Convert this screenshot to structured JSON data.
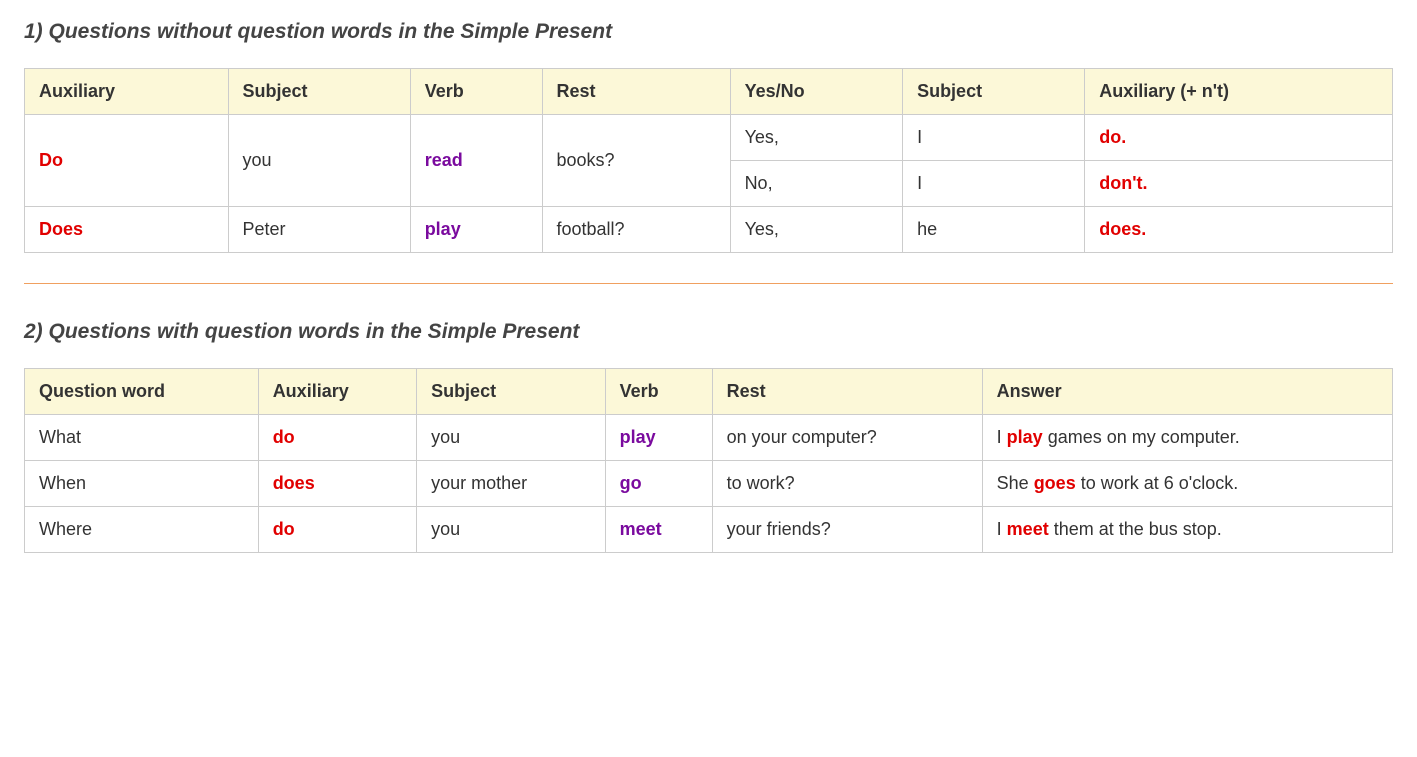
{
  "section1": {
    "heading": "1) Questions without question words in the Simple Present",
    "headers": {
      "aux": "Auxiliary",
      "subject": "Subject",
      "verb": "Verb",
      "rest": "Rest",
      "yesno": "Yes/No",
      "subject2": "Subject",
      "aux2": "Auxiliary (+ n't)"
    },
    "rows": {
      "r1": {
        "aux": "Do",
        "subject": "you",
        "verb": "read",
        "rest": "books?",
        "yesno": "Yes,",
        "subject2": "I",
        "aux2": "do."
      },
      "r2": {
        "yesno": "No,",
        "subject2": "I",
        "aux2": "don't."
      },
      "r3": {
        "aux": "Does",
        "subject": "Peter",
        "verb": "play",
        "rest": "football?",
        "yesno": "Yes,",
        "subject2": "he",
        "aux2": "does."
      }
    }
  },
  "section2": {
    "heading": "2) Questions with question words in the Simple Present",
    "headers": {
      "qword": "Question word",
      "aux": "Auxiliary",
      "subject": "Subject",
      "verb": "Verb",
      "rest": "Rest",
      "answer": "Answer"
    },
    "rows": {
      "r1": {
        "qword": "What",
        "aux": "do",
        "subject": "you",
        "verb": "play",
        "rest": "on your computer?",
        "ans_pre": "I ",
        "ans_hl": "play",
        "ans_post": " games on my computer."
      },
      "r2": {
        "qword": "When",
        "aux": "does",
        "subject": "your mother",
        "verb": "go",
        "rest": "to work?",
        "ans_pre": "She ",
        "ans_hl": "goes",
        "ans_post": " to work at 6 o'clock."
      },
      "r3": {
        "qword": "Where",
        "aux": "do",
        "subject": "you",
        "verb": "meet",
        "rest": "your friends?",
        "ans_pre": "I ",
        "ans_hl": "meet",
        "ans_post": " them at the bus stop."
      }
    }
  }
}
